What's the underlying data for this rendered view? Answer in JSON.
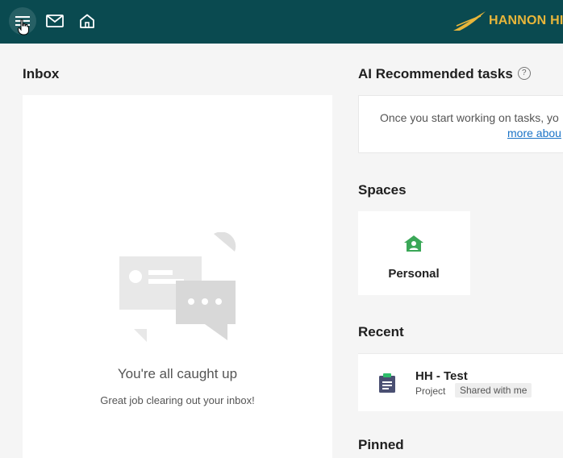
{
  "header": {
    "menu_icon": "hamburger-menu-icon",
    "mail_icon": "mail-icon",
    "home_icon": "home-icon",
    "logo_text": "HANNON HI",
    "bg_color": "#0a4a50",
    "logo_color": "#e8b63a"
  },
  "inbox": {
    "title": "Inbox",
    "empty_title": "You're all caught up",
    "empty_subtitle": "Great job clearing out your inbox!"
  },
  "ai_tasks": {
    "title": "AI Recommended tasks",
    "help_glyph": "?",
    "message": "Once you start working on tasks, yo",
    "link_text": "more abou"
  },
  "spaces": {
    "title": "Spaces",
    "items": [
      {
        "label": "Personal",
        "icon": "personal-space-icon",
        "icon_color": "#3aa757"
      }
    ]
  },
  "recent": {
    "title": "Recent",
    "items": [
      {
        "name": "HH - Test",
        "type": "Project",
        "badge": "Shared with me",
        "icon": "project-clipboard-icon"
      }
    ]
  },
  "next_section": {
    "title": "Pinned"
  }
}
